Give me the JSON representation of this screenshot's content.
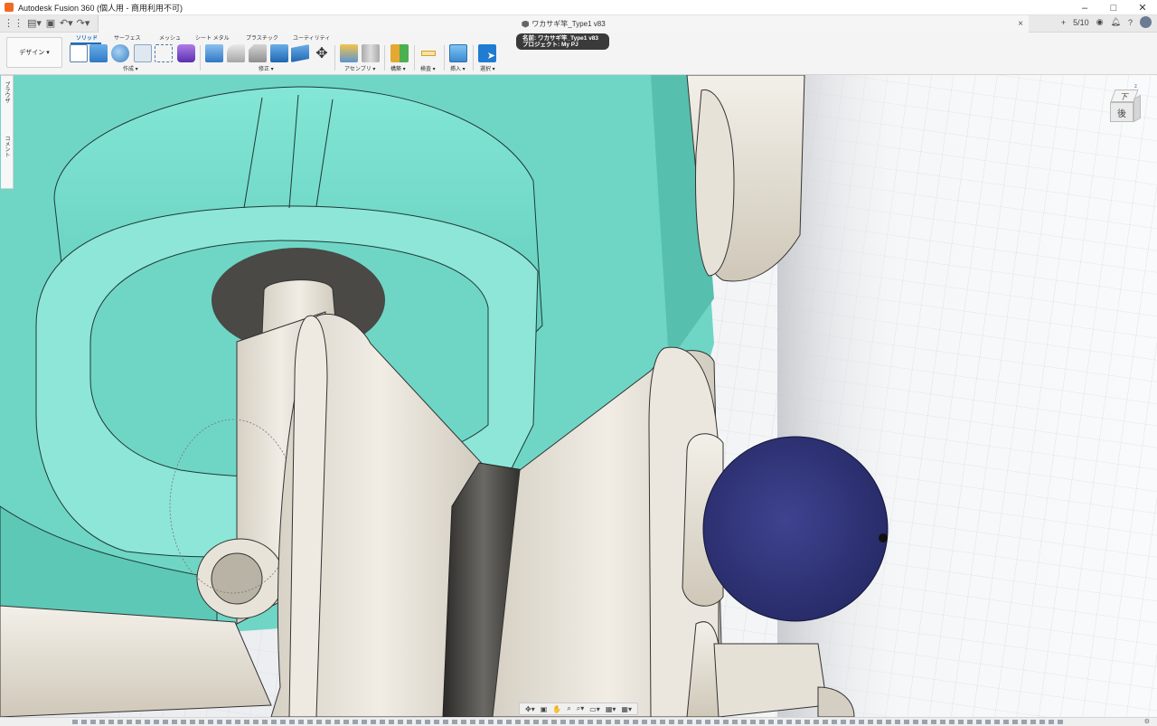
{
  "window": {
    "title": "Autodesk Fusion 360 (個人用 - 商用利用不可)",
    "controls": {
      "minimize": "–",
      "maximize": "□",
      "close": "✕"
    }
  },
  "tab_bar": {
    "document_tab": "ワカサギ竿_Type1 v83",
    "close": "×",
    "add": "+",
    "job_count": "5/10"
  },
  "toolbar": {
    "workspace": "デザイン ▾",
    "tabs": [
      "ソリッド",
      "サーフェス",
      "メッシュ",
      "シート メタル",
      "プラスチック",
      "ユーティリティ"
    ],
    "groups": [
      "作成 ▾",
      "修正 ▾",
      "アセンブリ ▾",
      "構築 ▾",
      "検査 ▾",
      "挿入 ▾",
      "選択 ▾"
    ]
  },
  "tooltip": {
    "name_line": "名前: ワカサギ竿_Type1 v83",
    "project_line": "プロジェクト: My PJ"
  },
  "browser_tabs": [
    "ブラウザ",
    "コメント"
  ],
  "viewcube": {
    "top_label": "下",
    "face_label": "後"
  },
  "colors": {
    "accent": "#1d6fb8",
    "teal_body": "#7fe0d0",
    "ball": "#35397c",
    "metal": "#e6e1d6",
    "logo": "#f26a21"
  }
}
